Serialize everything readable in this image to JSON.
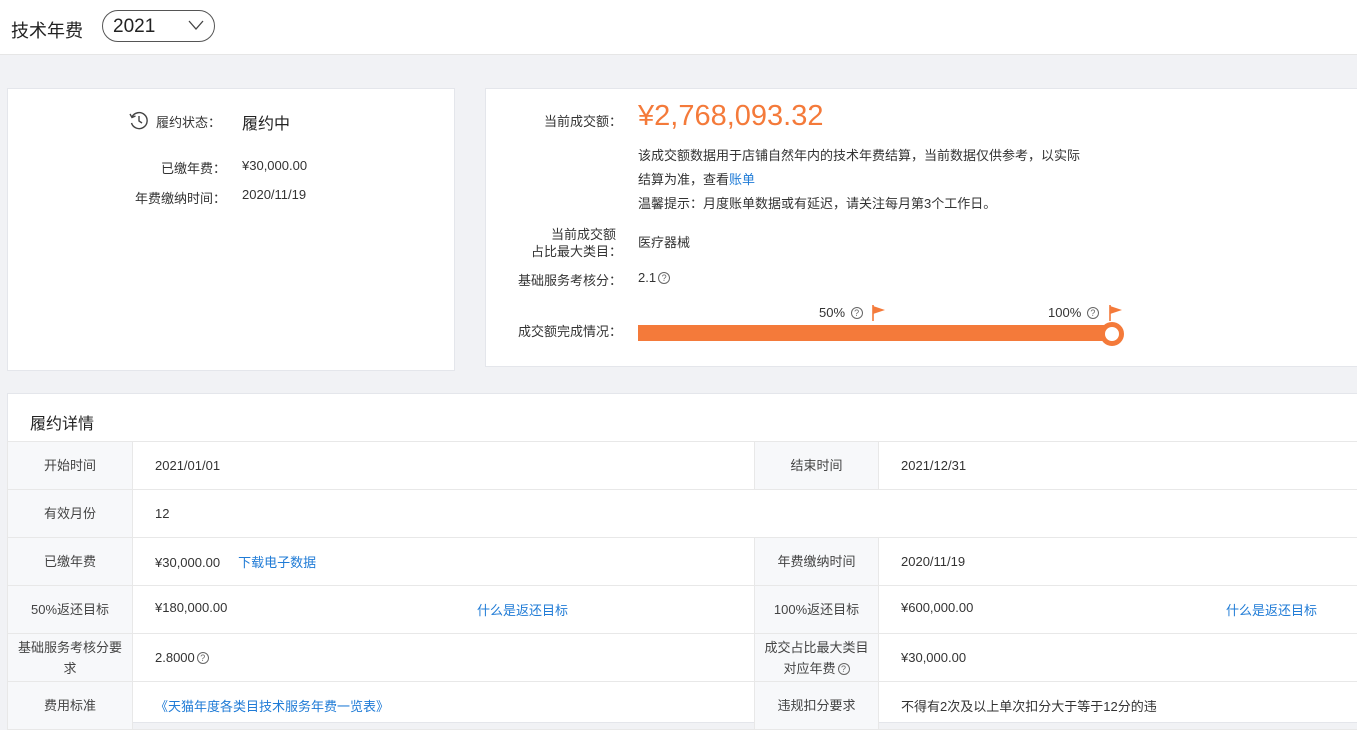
{
  "header": {
    "title": "技术年费",
    "year": "2021"
  },
  "status_card": {
    "status_label": "履约状态：",
    "status_value": "履约中",
    "paid_label": "已缴年费：",
    "paid_value": "¥30,000.00",
    "paytime_label": "年费缴纳时间：",
    "paytime_value": "2020/11/19"
  },
  "summary_card": {
    "amount_label": "当前成交额：",
    "amount_value": "¥2,768,093.32",
    "note_line1": "该成交额数据用于店铺自然年内的技术年费结算，当前数据仅供参考，以实际",
    "note_line2_prefix": "结算为准，查看",
    "note_link": "账单",
    "note_line3": "温馨提示：月度账单数据或有延迟，请关注每月第3个工作日。",
    "category_label_1": "当前成交额",
    "category_label_2": "占比最大类目：",
    "category_value": "医疗器械",
    "score_label": "基础服务考核分：",
    "score_value": "2.1",
    "progress_label": "成交额完成情况：",
    "tick_50": "50%",
    "tick_100": "100%",
    "progress_fraction": 1.0,
    "accent_color": "#f47a3a"
  },
  "detail": {
    "title": "履约详情",
    "start_label": "开始时间",
    "start_value": "2021/01/01",
    "end_label": "结束时间",
    "end_value": "2021/12/31",
    "months_label": "有效月份",
    "months_value": "12",
    "paid_label": "已缴年费",
    "paid_value": "¥30,000.00",
    "download_link": "下载电子数据",
    "paytime_label": "年费缴纳时间",
    "paytime_value": "2020/11/19",
    "t50_label": "50%返还目标",
    "t50_value": "¥180,000.00",
    "t50_link": "什么是返还目标",
    "t100_label": "100%返还目标",
    "t100_value": "¥600,000.00",
    "t100_link": "什么是返还目标",
    "score_req_label": "基础服务考核分要求",
    "score_req_value": "2.8000",
    "cat_fee_label_1": "成交占比最大类目",
    "cat_fee_label_2": "对应年费",
    "cat_fee_value": "¥30,000.00",
    "fee_std_label": "费用标准",
    "fee_std_link": "《天猫年度各类目技术服务年费一览表》",
    "penalty_label": "违规扣分要求",
    "penalty_value": "不得有2次及以上单次扣分大于等于12分的违"
  }
}
